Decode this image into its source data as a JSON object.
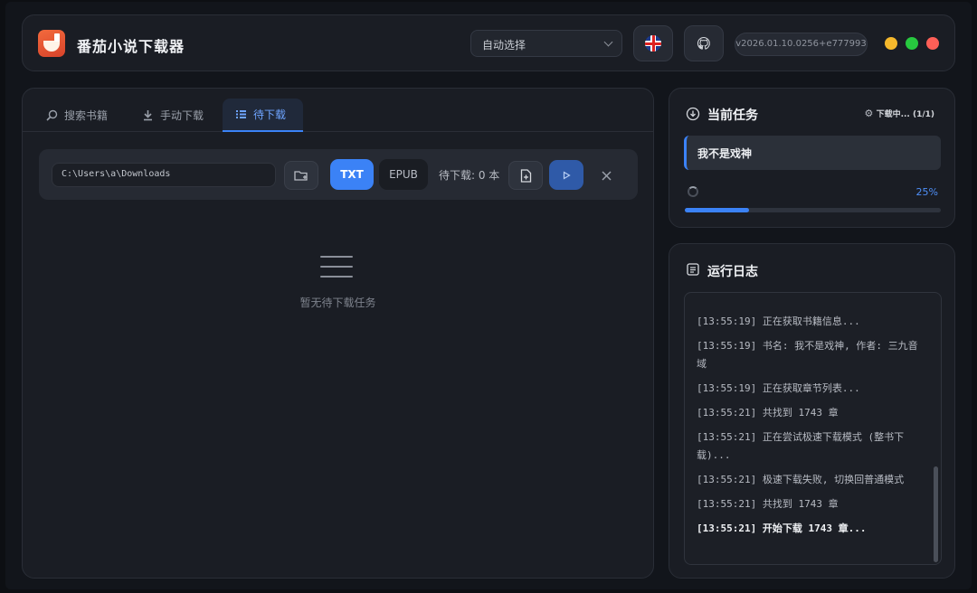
{
  "app": {
    "title": "番茄小说下载器",
    "version": "v2026.01.10.0256+e777993"
  },
  "header": {
    "source_select": "自动选择"
  },
  "window_controls": {
    "minimize": "#f5b82c",
    "maximize": "#27c93f",
    "close": "#ff5f57"
  },
  "tabs": [
    {
      "label": "搜索书籍",
      "icon": "search-icon"
    },
    {
      "label": "手动下载",
      "icon": "download-icon"
    },
    {
      "label": "待下载",
      "icon": "list-icon",
      "active": true
    }
  ],
  "toolbar": {
    "path_value": "C:\\Users\\a\\Downloads",
    "format_txt": "TXT",
    "format_epub": "EPUB",
    "pending_count": "待下载: 0 本"
  },
  "queue": {
    "empty_text": "暂无待下载任务"
  },
  "current_task": {
    "title": "当前任务",
    "status": "下载中... (1/1)",
    "book_name": "我不是戏神",
    "progress_label": "25%",
    "progress": 0.25
  },
  "log": {
    "title": "运行日志",
    "lines": [
      "[13:55:19] 正在获取书籍信息...",
      "[13:55:19] 书名: 我不是戏神, 作者: 三九音域",
      "[13:55:19] 正在获取章节列表...",
      "[13:55:21] 共找到 1743 章",
      "[13:55:21] 正在尝试极速下载模式 (整书下载)...",
      "[13:55:21] 极速下载失败, 切换回普通模式",
      "[13:55:21] 共找到 1743 章",
      "[13:55:21] 开始下载 1743 章..."
    ]
  },
  "accent": "#3b82f6"
}
